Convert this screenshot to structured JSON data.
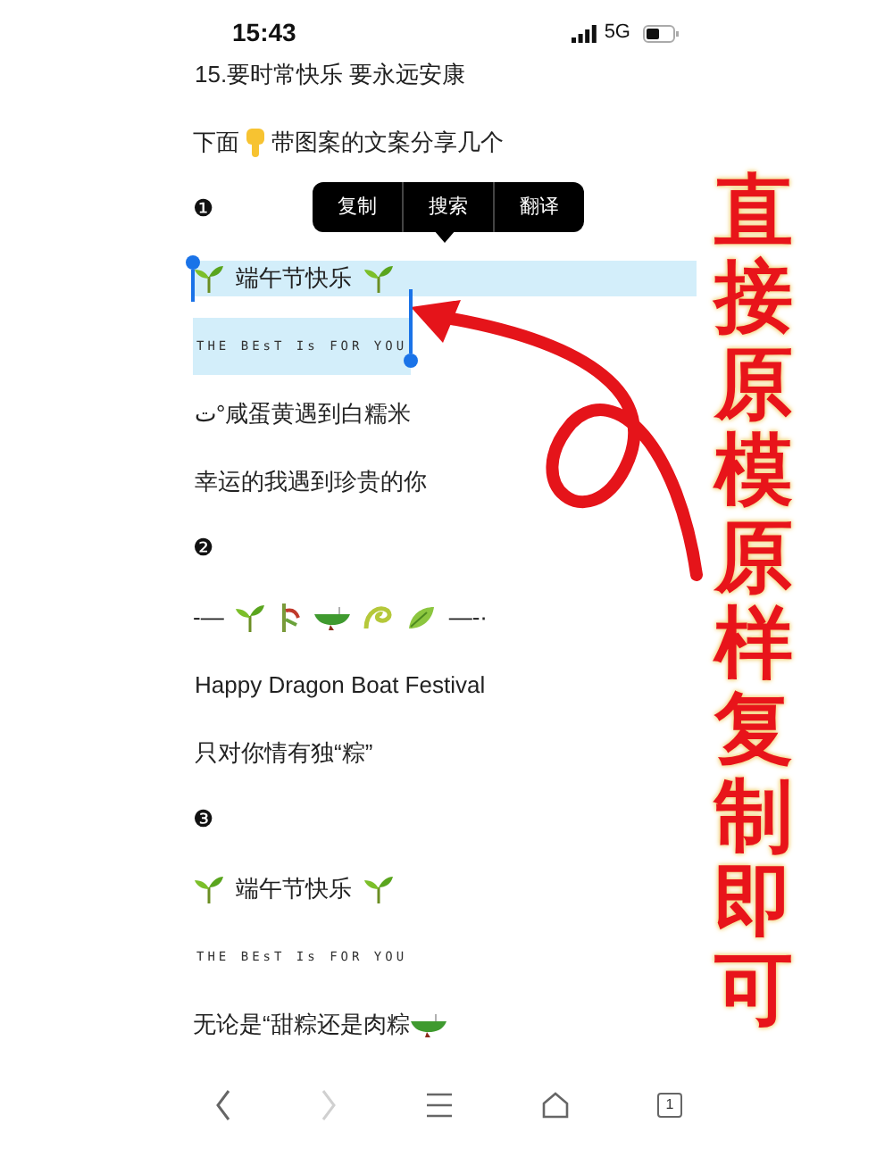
{
  "status_bar": {
    "time": "15:43",
    "network": "5G"
  },
  "context_menu": [
    "复制",
    "搜索",
    "翻译"
  ],
  "lines": [
    {
      "kind": "text",
      "text": "15.要时常快乐 要永远安康",
      "selected": false
    },
    {
      "kind": "hand",
      "before": "下面",
      "after": "带图案的文案分享几个",
      "selected": false
    },
    {
      "kind": "number",
      "text": "❶",
      "selected": false
    },
    {
      "kind": "sprout",
      "text": "端午节快乐",
      "selected": true
    },
    {
      "kind": "small",
      "text": "THE BEsT Is FOR YOU",
      "selected": true
    },
    {
      "kind": "text",
      "text": "ت°咸蛋黄遇到白糯米",
      "selected": false
    },
    {
      "kind": "text",
      "text": "幸运的我遇到珍贵的你",
      "selected": false
    },
    {
      "kind": "number",
      "text": "❷",
      "selected": false
    },
    {
      "kind": "deco",
      "left": "-—",
      "right": "—-·",
      "selected": false
    },
    {
      "kind": "text",
      "text": "Happy Dragon Boat Festival",
      "selected": false
    },
    {
      "kind": "text",
      "text": "只对你情有独“粽”",
      "selected": false
    },
    {
      "kind": "number",
      "text": "❸",
      "selected": false
    },
    {
      "kind": "sprout",
      "text": "端午节快乐",
      "selected": false
    },
    {
      "kind": "small",
      "text": "THE BEsT Is FOR YOU",
      "selected": false
    },
    {
      "kind": "boat_end",
      "text": "无论是“甜粽还是肉粽",
      "selected": false
    }
  ],
  "annotation": {
    "text": "直接原模原样复制即可"
  },
  "toolbar": [
    {
      "kind": "back",
      "disabled": false
    },
    {
      "kind": "forward",
      "disabled": true
    },
    {
      "kind": "menu",
      "disabled": false
    },
    {
      "kind": "home",
      "disabled": false
    },
    {
      "kind": "tabs",
      "count": "1",
      "disabled": false
    }
  ]
}
